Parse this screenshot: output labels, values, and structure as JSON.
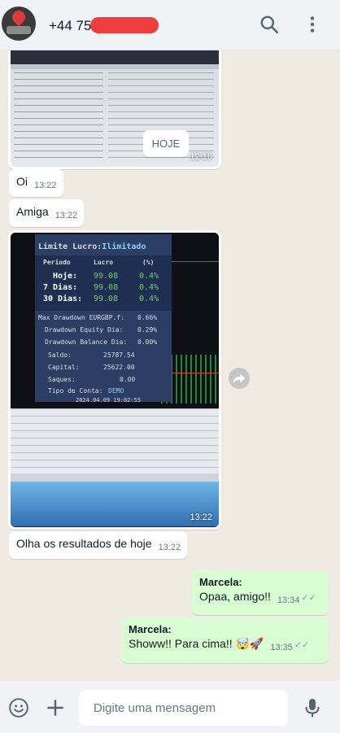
{
  "header": {
    "contact_number": "+44 75",
    "icons": [
      "avatar",
      "search-icon",
      "menu-icon"
    ]
  },
  "chat": {
    "image_message_1": {
      "time": "12:16"
    },
    "date_divider": "HOJE",
    "messages_in": [
      {
        "text": "Oi",
        "time": "13:22"
      },
      {
        "text": "Amiga",
        "time": "13:22"
      }
    ],
    "image_message_2": {
      "time": "13:22",
      "panel": {
        "title_label": "Limite Lucro:",
        "title_value": "Ilimitado",
        "col_periodo": "Periodo",
        "col_lucro": "Lucro",
        "col_pct": "(%)",
        "rows": [
          {
            "label": "Hoje:",
            "lucro": "99.08",
            "pct": "0.4%"
          },
          {
            "label": "7 Dias:",
            "lucro": "99.08",
            "pct": "0.4%"
          },
          {
            "label": "30 Dias:",
            "lucro": "99.08",
            "pct": "0.4%"
          }
        ],
        "max_dd_label": "Max Drawdown EURGBP.f:",
        "max_dd_value": "0.66%",
        "dd_equity_label": "Drawdown Equity Dia:",
        "dd_equity_value": "0.29%",
        "dd_balance_label": "Drawdown Balance Dia:",
        "dd_balance_value": "0.00%",
        "saldo_label": "Saldo:",
        "saldo_value": "25787.54",
        "capital_label": "Capital:",
        "capital_value": "25622.00",
        "saques_label": "Saques:",
        "saques_value": "0.00",
        "conta_label": "Tipo de Conta:",
        "conta_value": "DEMO",
        "timestamp": "2024.04.09 19:02:55"
      }
    },
    "caption": {
      "text": "Olha os resultados de hoje",
      "time": "13:22"
    },
    "messages_out": [
      {
        "sender": "Marcela:",
        "text": "Opaa, amigo!!",
        "time": "13:34",
        "ticks": "✓✓"
      },
      {
        "sender": "Marcela:",
        "text": "Showw!! Para cima!! 🤯🚀",
        "time": "13:35",
        "ticks": "✓✓"
      }
    ]
  },
  "composer": {
    "placeholder": "Digite uma mensagem",
    "icons": [
      "emoji-icon",
      "plus-icon",
      "mic-icon"
    ]
  }
}
